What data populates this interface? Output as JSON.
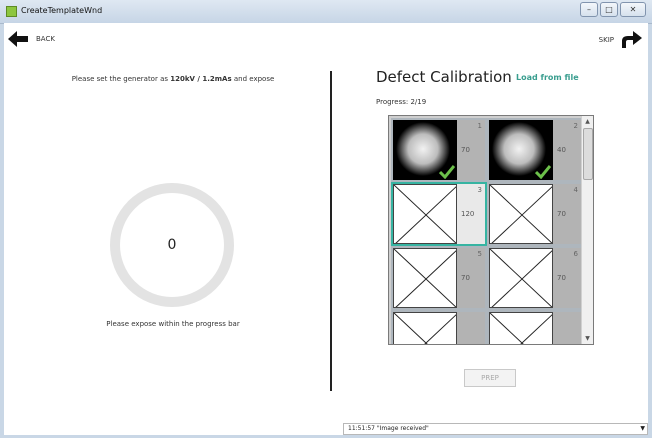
{
  "window": {
    "title": "CreateTemplateWnd",
    "controls": [
      "–",
      "□",
      "✕"
    ]
  },
  "nav": {
    "back_label": "BACK",
    "skip_label": "SKIP"
  },
  "left": {
    "instruction_prefix": "Please set the generator as",
    "instruction_value": "120kV / 1.2mAs",
    "instruction_suffix": "and expose",
    "progress_value": "0",
    "expose_hint": "Please expose within the progress bar"
  },
  "right": {
    "title": "Defect Calibration",
    "load_link": "Load from file",
    "progress_label": "Progress:",
    "progress_value": "2/19",
    "cells": [
      {
        "number": "1",
        "value": "70",
        "state": "done"
      },
      {
        "number": "2",
        "value": "40",
        "state": "done"
      },
      {
        "number": "3",
        "value": "120",
        "state": "active"
      },
      {
        "number": "4",
        "value": "70",
        "state": "pending"
      },
      {
        "number": "5",
        "value": "70",
        "state": "pending"
      },
      {
        "number": "6",
        "value": "70",
        "state": "pending"
      },
      {
        "number": "",
        "value": "",
        "state": "pending"
      },
      {
        "number": "",
        "value": "",
        "state": "pending"
      }
    ],
    "prep_button": "PREP"
  },
  "status": {
    "message": "11:51:57 \"Image received\""
  },
  "colors": {
    "accent": "#36b4a2",
    "link": "#3a9e8f",
    "check": "#6cc04a"
  }
}
